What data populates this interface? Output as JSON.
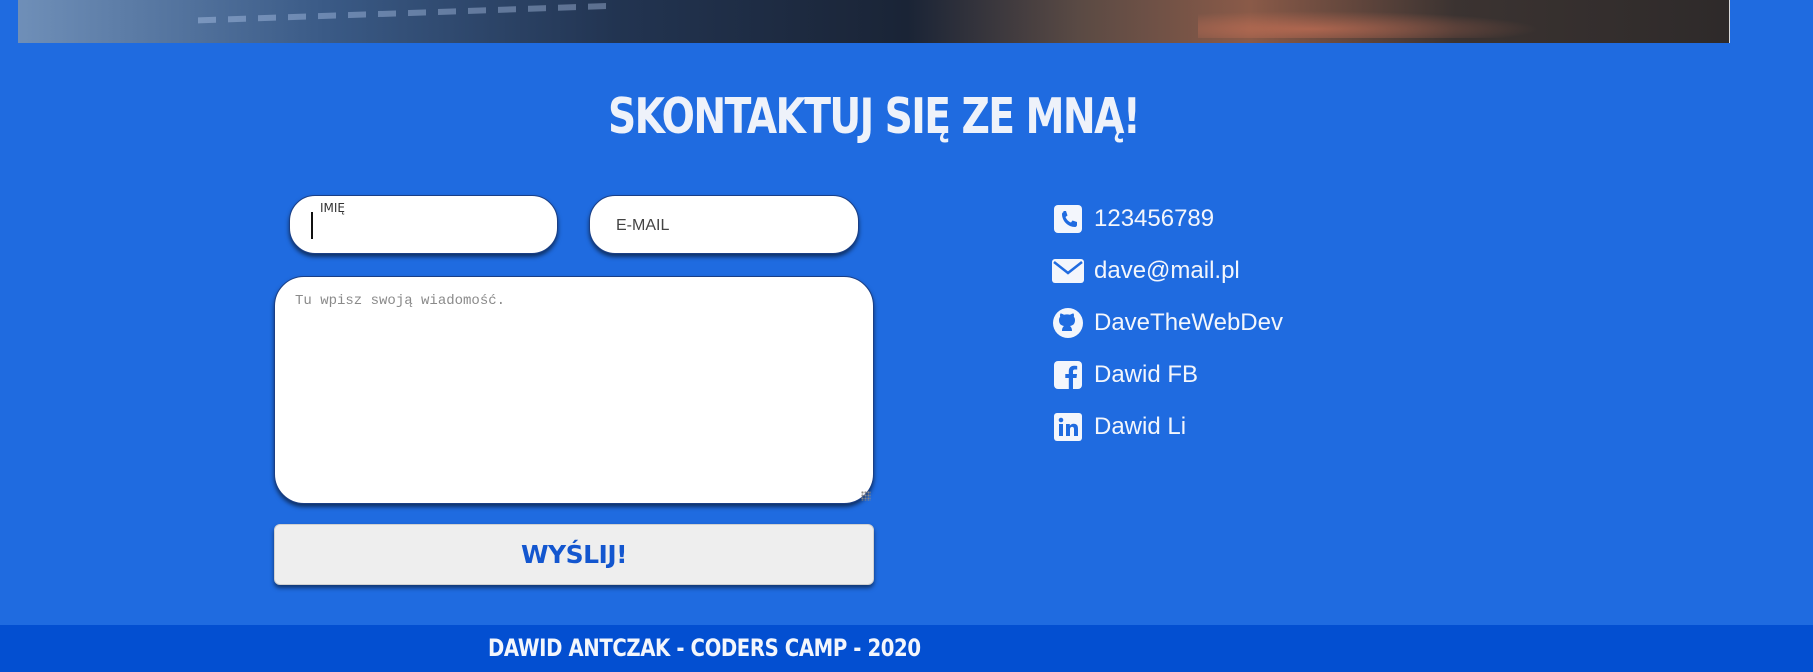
{
  "contact_section": {
    "title": "SKONTAKTUJ SIĘ ZE MNĄ!"
  },
  "form": {
    "name_label": "IMIĘ",
    "name_value": "",
    "email_placeholder": "E-MAIL",
    "message_placeholder": "Tu wpisz swoją wiadomość.",
    "submit_label": "WYŚLIJ!"
  },
  "contacts": [
    {
      "icon": "phone-icon",
      "text": "123456789"
    },
    {
      "icon": "envelope-icon",
      "text": "dave@mail.pl"
    },
    {
      "icon": "github-icon",
      "text": "DaveTheWebDev"
    },
    {
      "icon": "facebook-icon",
      "text": "Dawid FB"
    },
    {
      "icon": "linkedin-icon",
      "text": "Dawid Li"
    }
  ],
  "footer": {
    "text": "DAWID ANTCZAK - CODERS CAMP - 2020"
  },
  "colors": {
    "background": "#1f6be0",
    "footer": "#034fd1",
    "button_text": "#1356cf",
    "button_bg": "#eeeeee"
  }
}
